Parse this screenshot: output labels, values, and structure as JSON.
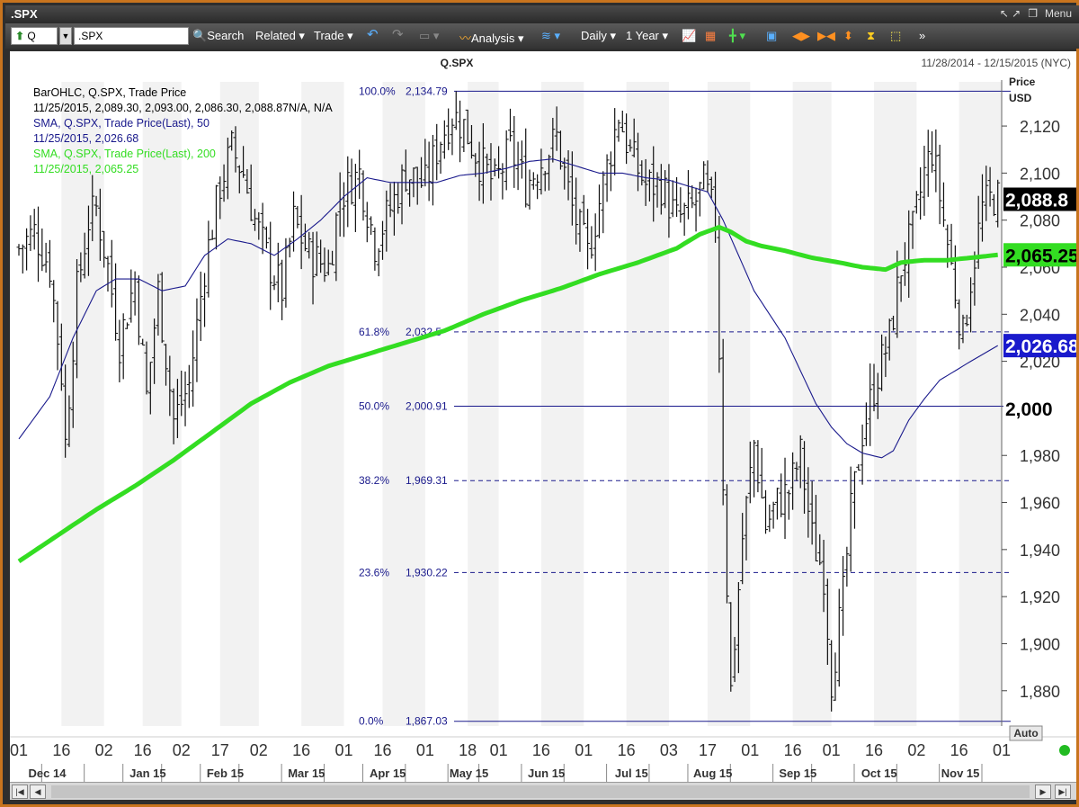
{
  "window": {
    "title": ".SPX",
    "controls": {
      "arrows": "↖ ↗",
      "restore": "❐",
      "menu": "Menu"
    }
  },
  "toolbar": {
    "symbol_prefix": "Q",
    "symbol_input": ".SPX",
    "search": "Search",
    "related": "Related",
    "trade": "Trade",
    "analysis": "Analysis",
    "interval": "Daily",
    "range": "1 Year"
  },
  "chart": {
    "symbol_title": "Q.SPX",
    "date_range": "11/28/2014 - 12/15/2015 (NYC)",
    "price_label": "Price",
    "currency_label": "USD",
    "auto_label": "Auto",
    "legend": [
      {
        "text": "BarOHLC, Q.SPX, Trade Price",
        "color": "#000000"
      },
      {
        "text": "11/25/2015, 2,089.30, 2,093.00, 2,086.30, 2,088.87N/A, N/A",
        "color": "#000000"
      },
      {
        "text": "SMA, Q.SPX, Trade Price(Last),  50",
        "color": "#1a1a8c"
      },
      {
        "text": "11/25/2015, 2,026.68",
        "color": "#1a1a8c"
      },
      {
        "text": "SMA, Q.SPX, Trade Price(Last),  200",
        "color": "#33dd22"
      },
      {
        "text": "11/25/2015, 2,065.25",
        "color": "#33dd22"
      }
    ],
    "badges": [
      {
        "text": "2,088.8",
        "value": 2088.87,
        "bg": "#000000",
        "fg": "#ffffff"
      },
      {
        "text": "2,065.25",
        "value": 2065.25,
        "bg": "#33dd22",
        "fg": "#000000"
      },
      {
        "text": "2,026.68",
        "value": 2026.68,
        "bg": "#1a1acc",
        "fg": "#ffffff"
      },
      {
        "text": "2,000",
        "value": 2000,
        "bg": "#ffffff",
        "fg": "#000000"
      }
    ]
  },
  "chart_data": {
    "type": "ohlc",
    "ylim": [
      1865,
      2138
    ],
    "y_ticks": [
      {
        "value": 1880,
        "label": "1,880"
      },
      {
        "value": 1900,
        "label": "1,900"
      },
      {
        "value": 1920,
        "label": "1,920"
      },
      {
        "value": 1940,
        "label": "1,940"
      },
      {
        "value": 1960,
        "label": "1,960"
      },
      {
        "value": 1980,
        "label": "1,980"
      },
      {
        "value": 2020,
        "label": "2,020"
      },
      {
        "value": 2040,
        "label": "2,040"
      },
      {
        "value": 2060,
        "label": "2,060"
      },
      {
        "value": 2080,
        "label": "2,080"
      },
      {
        "value": 2100,
        "label": "2,100"
      },
      {
        "value": 2120,
        "label": "2,120"
      }
    ],
    "x_ticks": [
      {
        "t": 0,
        "label": "01"
      },
      {
        "t": 11,
        "label": "16"
      },
      {
        "t": 22,
        "label": "02"
      },
      {
        "t": 32,
        "label": "16"
      },
      {
        "t": 42,
        "label": "02"
      },
      {
        "t": 52,
        "label": "17"
      },
      {
        "t": 62,
        "label": "02"
      },
      {
        "t": 73,
        "label": "16"
      },
      {
        "t": 84,
        "label": "01"
      },
      {
        "t": 94,
        "label": "16"
      },
      {
        "t": 105,
        "label": "01"
      },
      {
        "t": 116,
        "label": "18"
      },
      {
        "t": 124,
        "label": "01"
      },
      {
        "t": 135,
        "label": "16"
      },
      {
        "t": 146,
        "label": "01"
      },
      {
        "t": 157,
        "label": "16"
      },
      {
        "t": 168,
        "label": "03"
      },
      {
        "t": 178,
        "label": "17"
      },
      {
        "t": 189,
        "label": "01"
      },
      {
        "t": 200,
        "label": "16"
      },
      {
        "t": 210,
        "label": "01"
      },
      {
        "t": 221,
        "label": "16"
      },
      {
        "t": 232,
        "label": "02"
      },
      {
        "t": 243,
        "label": "16"
      },
      {
        "t": 254,
        "label": "01"
      }
    ],
    "months": [
      {
        "t": 5,
        "label": "Dec 14"
      },
      {
        "t": 31,
        "label": "Jan 15"
      },
      {
        "t": 51,
        "label": "Feb 15"
      },
      {
        "t": 72,
        "label": "Mar 15"
      },
      {
        "t": 93,
        "label": "Apr 15"
      },
      {
        "t": 114,
        "label": "May 15"
      },
      {
        "t": 134,
        "label": "Jun 15"
      },
      {
        "t": 156,
        "label": "Jul 15"
      },
      {
        "t": 177,
        "label": "Aug 15"
      },
      {
        "t": 199,
        "label": "Sep 15"
      },
      {
        "t": 220,
        "label": "Oct 15"
      },
      {
        "t": 241,
        "label": "Nov 15"
      }
    ],
    "fibonacci": [
      {
        "pct": "100.0%",
        "value": 2134.79,
        "label": "2,134.79",
        "style": "solid"
      },
      {
        "pct": "61.8%",
        "value": 2032.5,
        "label": "2,032.5",
        "style": "dashed"
      },
      {
        "pct": "50.0%",
        "value": 2000.91,
        "label": "2,000.91",
        "style": "solid"
      },
      {
        "pct": "38.2%",
        "value": 1969.31,
        "label": "1,969.31",
        "style": "dashed"
      },
      {
        "pct": "23.6%",
        "value": 1930.22,
        "label": "1,930.22",
        "style": "dashed"
      },
      {
        "pct": "0.0%",
        "value": 1867.03,
        "label": "1,867.03",
        "style": "solid"
      }
    ],
    "close_anchors": [
      [
        0,
        2068
      ],
      [
        4,
        2075
      ],
      [
        8,
        2060
      ],
      [
        11,
        2015
      ],
      [
        12,
        1985
      ],
      [
        15,
        2050
      ],
      [
        18,
        2080
      ],
      [
        20,
        2085
      ],
      [
        23,
        2060
      ],
      [
        26,
        2028
      ],
      [
        30,
        2055
      ],
      [
        33,
        2005
      ],
      [
        36,
        2050
      ],
      [
        40,
        1995
      ],
      [
        44,
        2010
      ],
      [
        48,
        2060
      ],
      [
        52,
        2095
      ],
      [
        55,
        2110
      ],
      [
        58,
        2100
      ],
      [
        61,
        2080
      ],
      [
        65,
        2060
      ],
      [
        68,
        2050
      ],
      [
        71,
        2080
      ],
      [
        75,
        2065
      ],
      [
        80,
        2060
      ],
      [
        83,
        2090
      ],
      [
        88,
        2100
      ],
      [
        92,
        2070
      ],
      [
        96,
        2085
      ],
      [
        100,
        2100
      ],
      [
        105,
        2095
      ],
      [
        109,
        2115
      ],
      [
        112,
        2125
      ],
      [
        115,
        2120
      ],
      [
        119,
        2105
      ],
      [
        123,
        2095
      ],
      [
        127,
        2110
      ],
      [
        131,
        2095
      ],
      [
        135,
        2105
      ],
      [
        139,
        2115
      ],
      [
        143,
        2085
      ],
      [
        147,
        2065
      ],
      [
        151,
        2095
      ],
      [
        155,
        2125
      ],
      [
        158,
        2108
      ],
      [
        162,
        2095
      ],
      [
        166,
        2095
      ],
      [
        170,
        2080
      ],
      [
        174,
        2085
      ],
      [
        177,
        2095
      ],
      [
        180,
        2080
      ],
      [
        182,
        1970
      ],
      [
        184,
        1880
      ],
      [
        187,
        1945
      ],
      [
        190,
        1985
      ],
      [
        193,
        1950
      ],
      [
        196,
        1960
      ],
      [
        199,
        1965
      ],
      [
        202,
        1980
      ],
      [
        205,
        1945
      ],
      [
        208,
        1930
      ],
      [
        210,
        1885
      ],
      [
        213,
        1920
      ],
      [
        215,
        1955
      ],
      [
        218,
        1990
      ],
      [
        222,
        2015
      ],
      [
        225,
        2030
      ],
      [
        228,
        2060
      ],
      [
        231,
        2075
      ],
      [
        234,
        2100
      ],
      [
        236,
        2110
      ],
      [
        239,
        2080
      ],
      [
        242,
        2050
      ],
      [
        244,
        2030
      ],
      [
        246,
        2055
      ],
      [
        249,
        2085
      ],
      [
        252,
        2090
      ],
      [
        253,
        2089
      ]
    ],
    "sma50": [
      [
        0,
        1987
      ],
      [
        8,
        2005
      ],
      [
        14,
        2030
      ],
      [
        20,
        2050
      ],
      [
        25,
        2055
      ],
      [
        31,
        2055
      ],
      [
        37,
        2050
      ],
      [
        43,
        2052
      ],
      [
        48,
        2065
      ],
      [
        54,
        2072
      ],
      [
        60,
        2070
      ],
      [
        66,
        2065
      ],
      [
        72,
        2072
      ],
      [
        78,
        2080
      ],
      [
        84,
        2090
      ],
      [
        90,
        2098
      ],
      [
        96,
        2096
      ],
      [
        102,
        2096
      ],
      [
        108,
        2096
      ],
      [
        114,
        2099
      ],
      [
        120,
        2100
      ],
      [
        126,
        2102
      ],
      [
        132,
        2105
      ],
      [
        138,
        2106
      ],
      [
        144,
        2103
      ],
      [
        150,
        2100
      ],
      [
        156,
        2100
      ],
      [
        162,
        2098
      ],
      [
        168,
        2097
      ],
      [
        174,
        2094
      ],
      [
        178,
        2092
      ],
      [
        182,
        2080
      ],
      [
        186,
        2065
      ],
      [
        190,
        2050
      ],
      [
        194,
        2040
      ],
      [
        198,
        2030
      ],
      [
        202,
        2016
      ],
      [
        206,
        2002
      ],
      [
        210,
        1992
      ],
      [
        214,
        1985
      ],
      [
        218,
        1981
      ],
      [
        223,
        1979
      ],
      [
        226,
        1982
      ],
      [
        230,
        1995
      ],
      [
        234,
        2004
      ],
      [
        238,
        2012
      ],
      [
        242,
        2016
      ],
      [
        246,
        2020
      ],
      [
        253,
        2026.68
      ]
    ],
    "sma200": [
      [
        0,
        1935
      ],
      [
        10,
        1946
      ],
      [
        20,
        1957
      ],
      [
        30,
        1967
      ],
      [
        40,
        1978
      ],
      [
        50,
        1990
      ],
      [
        60,
        2002
      ],
      [
        70,
        2011
      ],
      [
        80,
        2018
      ],
      [
        90,
        2023
      ],
      [
        100,
        2028
      ],
      [
        110,
        2033
      ],
      [
        120,
        2040
      ],
      [
        130,
        2046
      ],
      [
        140,
        2051
      ],
      [
        150,
        2057
      ],
      [
        160,
        2062
      ],
      [
        170,
        2068
      ],
      [
        176,
        2074
      ],
      [
        181,
        2077
      ],
      [
        184,
        2075
      ],
      [
        188,
        2071
      ],
      [
        192,
        2069
      ],
      [
        198,
        2067
      ],
      [
        205,
        2064
      ],
      [
        212,
        2062
      ],
      [
        218,
        2060
      ],
      [
        224,
        2059
      ],
      [
        228,
        2062
      ],
      [
        234,
        2063
      ],
      [
        240,
        2063
      ],
      [
        246,
        2064
      ],
      [
        253,
        2065.25
      ]
    ],
    "n_bars": 254
  }
}
